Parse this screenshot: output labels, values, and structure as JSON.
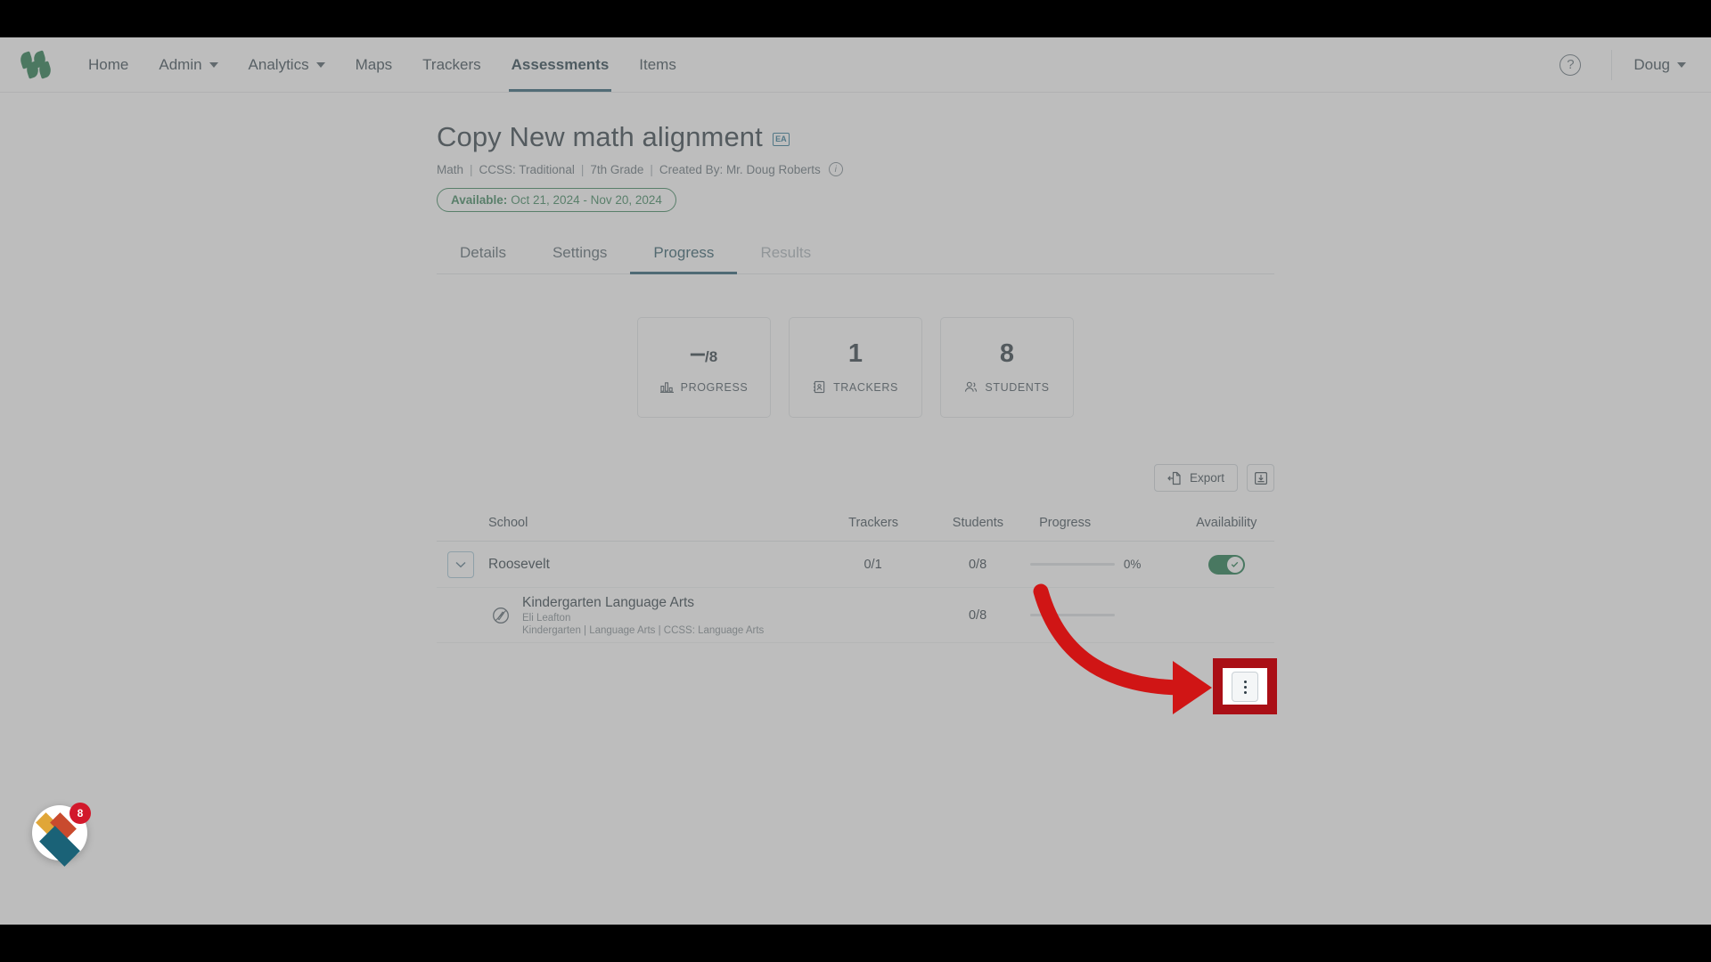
{
  "nav": {
    "logo_name": "masterly-logo",
    "links": [
      {
        "label": "Home",
        "has_caret": false,
        "active": false
      },
      {
        "label": "Admin",
        "has_caret": true,
        "active": false
      },
      {
        "label": "Analytics",
        "has_caret": true,
        "active": false
      },
      {
        "label": "Maps",
        "has_caret": false,
        "active": false
      },
      {
        "label": "Trackers",
        "has_caret": false,
        "active": false
      },
      {
        "label": "Assessments",
        "has_caret": false,
        "active": true
      },
      {
        "label": "Items",
        "has_caret": false,
        "active": false
      }
    ],
    "help_label": "?",
    "user_name": "Doug"
  },
  "header": {
    "title": "Copy New math alignment",
    "title_badge": "EA",
    "meta": {
      "subject": "Math",
      "standard": "CCSS: Traditional",
      "grade": "7th Grade",
      "creator": "Created By: Mr. Doug Roberts",
      "info_icon": "i"
    },
    "availability": {
      "prefix": "Available:",
      "range": "Oct 21, 2024 - Nov 20, 2024",
      "color": "#2e7d52"
    }
  },
  "tabs": [
    {
      "label": "Details",
      "active": false,
      "disabled": false
    },
    {
      "label": "Settings",
      "active": false,
      "disabled": false
    },
    {
      "label": "Progress",
      "active": true,
      "disabled": false
    },
    {
      "label": "Results",
      "active": false,
      "disabled": true
    }
  ],
  "stats": [
    {
      "value": "‒",
      "value_sub": "/8",
      "label": "PROGRESS",
      "icon": "bar-chart-icon"
    },
    {
      "value": "1",
      "value_sub": "",
      "label": "TRACKERS",
      "icon": "tracker-icon"
    },
    {
      "value": "8",
      "value_sub": "",
      "label": "STUDENTS",
      "icon": "students-icon"
    }
  ],
  "toolbar": {
    "export_label": "Export",
    "export_icon": "file-export-icon",
    "download_icon": "download-tray-icon"
  },
  "table": {
    "headers": {
      "school": "School",
      "trackers": "Trackers",
      "students": "Students",
      "progress": "Progress",
      "availability": "Availability"
    },
    "rows": [
      {
        "type": "school",
        "name": "Roosevelt",
        "trackers": "0/1",
        "students": "0/8",
        "progress_pct": "0%",
        "progress_value": 0,
        "available": true,
        "toggle_color": "#0d7040"
      },
      {
        "type": "tracker",
        "name": "Kindergarten Language Arts",
        "owner": "Eli Leafton",
        "tags": "Kindergarten  |  Language Arts  |  CCSS: Language Arts",
        "trackers": "",
        "students": "0/8",
        "progress_pct": "",
        "progress_value": 0,
        "menu_icon": "kebab-menu-icon"
      }
    ]
  },
  "annotation": {
    "highlight_color": "#aa0f16",
    "arrow_color": "#d01515",
    "target": "kebab-menu-icon"
  },
  "chat_widget": {
    "badge_count": "8",
    "badge_color": "#d2182b",
    "icon": "support-chat-icon"
  }
}
